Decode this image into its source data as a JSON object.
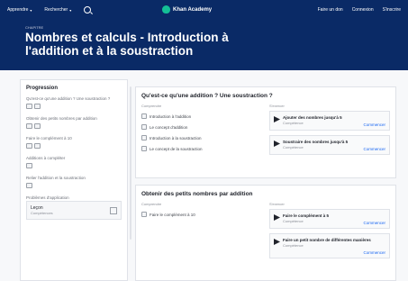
{
  "topbar": {
    "nav": [
      "Apprendre",
      "Rechercher"
    ],
    "brand": "Khan Academy",
    "right": [
      "Faire un don",
      "Connexion",
      "S'inscrire"
    ]
  },
  "hero": {
    "crumb": "CHAPITRE",
    "title_line1": "Nombres et calculs - Introduction à",
    "title_line2": "l'addition et à la soustraction"
  },
  "sidebar": {
    "title": "Progression",
    "items": [
      {
        "label": "Qu'est-ce qu'une addition ? Une soustraction ?"
      },
      {
        "label": "Obtenir des petits nombres par addition"
      },
      {
        "label": "Faire le complément à 10"
      },
      {
        "label": "Additions à compléter"
      },
      {
        "label": "Relier l'addition et la soustraction"
      }
    ],
    "active": {
      "name": "Problèmes d'application",
      "sub": "Leçon",
      "detail": "Compétences"
    }
  },
  "card1": {
    "title": "Qu'est-ce qu'une addition ? Une soustraction ?",
    "left_head": "Comprendre",
    "rows": [
      "Introduction à l'addition",
      "Le concept d'addition",
      "Introduction à la soustraction",
      "Le concept de la soustraction"
    ],
    "right_head": "S'exercer",
    "tasks": [
      {
        "name": "Ajouter des nombres jusqu'à 5",
        "sub": "Compétence",
        "action": "Commencer"
      },
      {
        "name": "Soustraire des nombres jusqu'à 5",
        "sub": "Compétence",
        "action": "Commencer"
      }
    ]
  },
  "card2": {
    "title": "Obtenir des petits nombres par addition",
    "left_head": "Comprendre",
    "rows": [
      "Faire le complément à 10"
    ],
    "right_head": "S'exercer",
    "tasks": [
      {
        "name": "Faire le complément à 5",
        "sub": "Compétence",
        "action": "Commencer"
      },
      {
        "name": "Faire un petit nombre de différentes manières",
        "sub": "Compétence",
        "action": "Commencer"
      }
    ]
  }
}
